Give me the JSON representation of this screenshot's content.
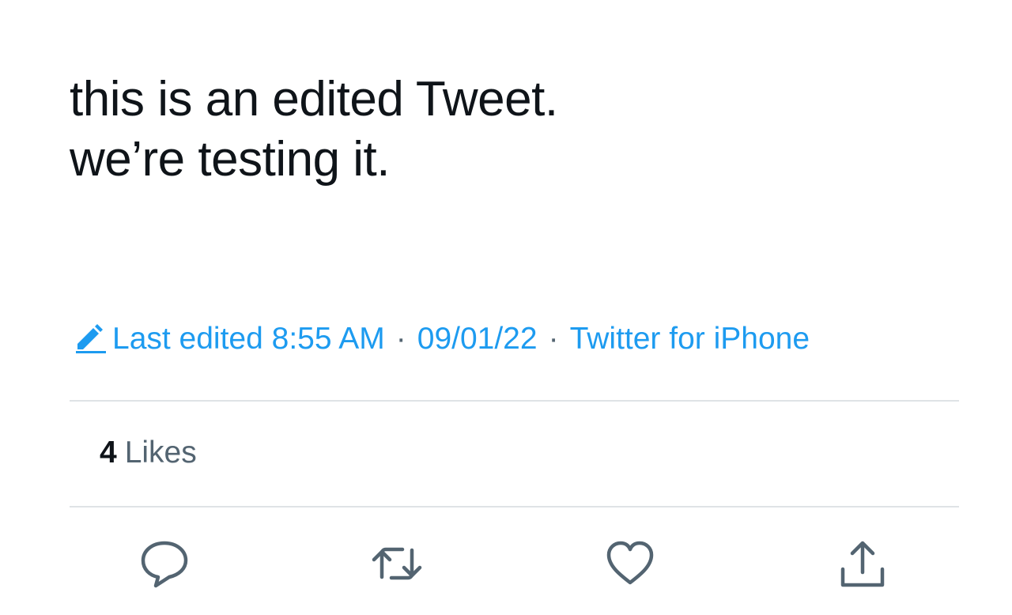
{
  "tweet": {
    "lines": [
      "this is an edited Tweet.",
      "we’re testing it."
    ]
  },
  "meta": {
    "edited_label": "Last edited 8:55 AM",
    "separator": "·",
    "date": "09/01/22",
    "source": "Twitter for iPhone",
    "edit_icon": "pencil-icon",
    "accent_color": "#1d9bf0"
  },
  "stats": {
    "likes_count": "4",
    "likes_label": "Likes"
  },
  "actions": {
    "reply_icon": "reply-icon",
    "retweet_icon": "retweet-icon",
    "like_icon": "heart-icon",
    "share_icon": "share-icon",
    "icon_color": "#536471"
  }
}
